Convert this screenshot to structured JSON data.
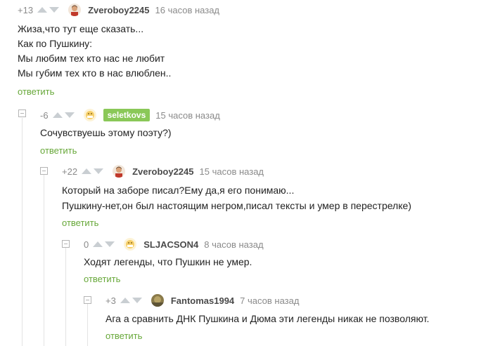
{
  "comments": [
    {
      "rating": "+13",
      "author": "Zveroboy2245",
      "time": "16 часов назад",
      "lines": [
        "Жиза,что тут еще сказать...",
        "Как по Пушкину:",
        "Мы любим тех кто нас не любит",
        "Мы губим тех кто в нас влюблен.."
      ],
      "reply": "ответить",
      "avatar": "man-avatar-icon"
    },
    {
      "rating": "-6",
      "author": "seletkovs",
      "time": "15 часов назад",
      "lines": [
        "Сочувствуешь этому поэту?)"
      ],
      "reply": "ответить",
      "avatar": "default-avatar-icon"
    },
    {
      "rating": "+22",
      "author": "Zveroboy2245",
      "time": "15 часов назад",
      "lines": [
        "Который на заборе писал?Ему да,я его понимаю...",
        "Пушкину-нет,он был настоящим негром,писал тексты и умер в перестрелке)"
      ],
      "reply": "ответить",
      "avatar": "man-avatar-icon"
    },
    {
      "rating": "0",
      "author": "SLJACSON4",
      "time": "8 часов назад",
      "lines": [
        "Ходят легенды, что Пушкин не умер."
      ],
      "reply": "ответить",
      "avatar": "default-avatar-icon"
    },
    {
      "rating": "+3",
      "author": "Fantomas1994",
      "time": "7 часов назад",
      "lines": [
        "Ага а сравнить ДНК Пушкина и Дюма эти легенды никак не позволяют."
      ],
      "reply": "ответить",
      "avatar": "photo-avatar-icon"
    }
  ],
  "colors": {
    "reply_link": "#67a839",
    "badge_bg": "#8ac858",
    "meta_text": "#8a8a8a",
    "arrow": "#c9ced2"
  }
}
